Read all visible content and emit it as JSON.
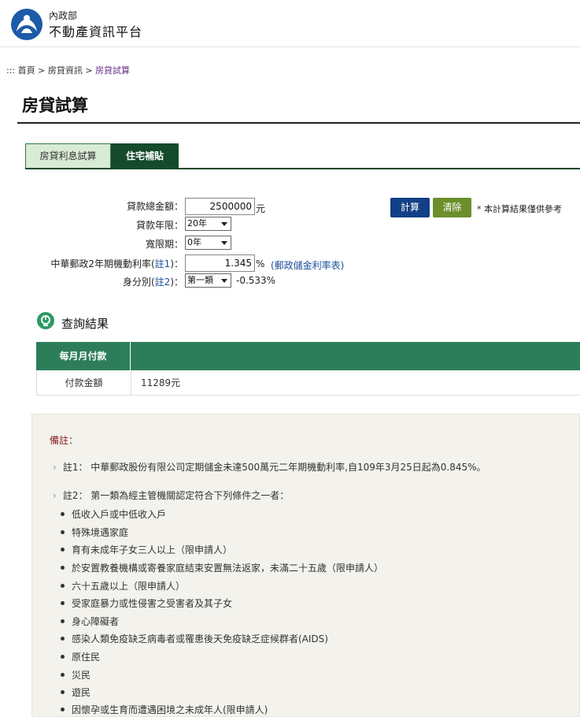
{
  "header": {
    "ministry": "內政部",
    "platform": "不動產資訊平台"
  },
  "breadcrumb": {
    "prefix": ":::",
    "home": "首頁",
    "sep1": ">",
    "section": "房貸資訊",
    "sep2": ">",
    "current": "房貸試算"
  },
  "page": {
    "title": "房貸試算"
  },
  "tabs": [
    {
      "label": "房貸利息試算",
      "active": false
    },
    {
      "label": "住宅補貼",
      "active": true
    }
  ],
  "form": {
    "loan_amount_label": "貸款總金額：",
    "loan_amount_value": "2500000",
    "loan_amount_unit": "元",
    "loan_years_label": "貸款年限：",
    "loan_years_value": "20年",
    "grace_label": "寬限期：",
    "grace_value": "0年",
    "rate_label_prefix": "中華郵政2年期機動利率(",
    "rate_label_note": "註1",
    "rate_label_suffix": ")：",
    "rate_value": "1.345",
    "rate_unit": "%",
    "rate_link": "(郵政儲金利率表)",
    "identity_label_prefix": "身分別(",
    "identity_label_note": "註2",
    "identity_label_suffix": ")：",
    "identity_value": "第一類",
    "identity_rate": "-0.533%"
  },
  "actions": {
    "calc": "計算",
    "clear": "清除",
    "note": "* 本計算結果僅供參考"
  },
  "result": {
    "title": "查詢結果",
    "header": "每月月付款",
    "row_label": "付款金額",
    "row_value": "11289元"
  },
  "notes": {
    "title": "備註：",
    "note1": "註1： 中華郵政股份有限公司定期儲金未達500萬元二年期機動利率,自109年3月25日起為0.845%。",
    "note2": "註2： 第一類為經主管機關認定符合下列條件之一者：",
    "items": [
      "低收入戶或中低收入戶",
      "特殊境遇家庭",
      "育有未成年子女三人以上（限申請人）",
      "於安置教養機構或寄養家庭結束安置無法返家，未滿二十五歲（限申請人）",
      "六十五歲以上（限申請人）",
      "受家庭暴力或性侵害之受害者及其子女",
      "身心障礙者",
      "感染人類免疫缺乏病毒者或罹患後天免疫缺乏症候群者(AIDS)",
      "原住民",
      "災民",
      "遊民",
      "因懷孕或生育而遭遇困境之未成年人(限申請人)"
    ]
  },
  "colors": {
    "tab_active": "#154a2d",
    "tab_inactive": "#d8ebd4",
    "table_header": "#2d7d5a",
    "calc_button": "#123f86",
    "clear_button": "#6b8f2a",
    "notes_title": "#8a1c1c"
  }
}
